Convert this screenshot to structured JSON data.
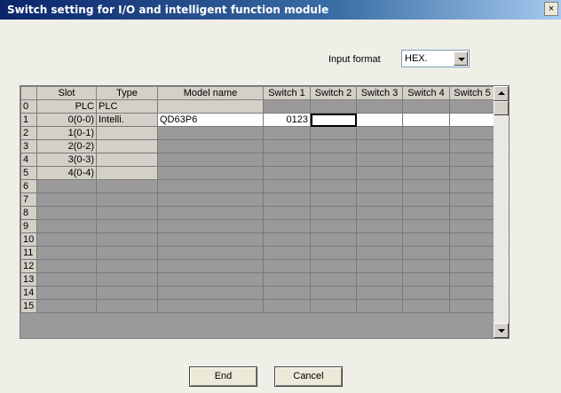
{
  "window": {
    "title": "Switch setting for I/O and intelligent function module",
    "close_label": "×"
  },
  "input_format": {
    "label": "Input format",
    "selected": "HEX."
  },
  "grid": {
    "columns": [
      "",
      "Slot",
      "Type",
      "Model name",
      "Switch 1",
      "Switch 2",
      "Switch 3",
      "Switch 4",
      "Switch 5"
    ],
    "rows": [
      {
        "index": "0",
        "slot": "PLC",
        "type": "PLC",
        "model": "",
        "s1": "",
        "s2": "",
        "s3": "",
        "s4": "",
        "s5": ""
      },
      {
        "index": "1",
        "slot": "0(0-0)",
        "type": "Intelli.",
        "model": "QD63P6",
        "s1": "0123",
        "s2": "",
        "s3": "",
        "s4": "",
        "s5": ""
      },
      {
        "index": "2",
        "slot": "1(0-1)",
        "type": "",
        "model": "",
        "s1": "",
        "s2": "",
        "s3": "",
        "s4": "",
        "s5": ""
      },
      {
        "index": "3",
        "slot": "2(0-2)",
        "type": "",
        "model": "",
        "s1": "",
        "s2": "",
        "s3": "",
        "s4": "",
        "s5": ""
      },
      {
        "index": "4",
        "slot": "3(0-3)",
        "type": "",
        "model": "",
        "s1": "",
        "s2": "",
        "s3": "",
        "s4": "",
        "s5": ""
      },
      {
        "index": "5",
        "slot": "4(0-4)",
        "type": "",
        "model": "",
        "s1": "",
        "s2": "",
        "s3": "",
        "s4": "",
        "s5": ""
      },
      {
        "index": "6",
        "slot": "",
        "type": "",
        "model": "",
        "s1": "",
        "s2": "",
        "s3": "",
        "s4": "",
        "s5": ""
      },
      {
        "index": "7",
        "slot": "",
        "type": "",
        "model": "",
        "s1": "",
        "s2": "",
        "s3": "",
        "s4": "",
        "s5": ""
      },
      {
        "index": "8",
        "slot": "",
        "type": "",
        "model": "",
        "s1": "",
        "s2": "",
        "s3": "",
        "s4": "",
        "s5": ""
      },
      {
        "index": "9",
        "slot": "",
        "type": "",
        "model": "",
        "s1": "",
        "s2": "",
        "s3": "",
        "s4": "",
        "s5": ""
      },
      {
        "index": "10",
        "slot": "",
        "type": "",
        "model": "",
        "s1": "",
        "s2": "",
        "s3": "",
        "s4": "",
        "s5": ""
      },
      {
        "index": "11",
        "slot": "",
        "type": "",
        "model": "",
        "s1": "",
        "s2": "",
        "s3": "",
        "s4": "",
        "s5": ""
      },
      {
        "index": "12",
        "slot": "",
        "type": "",
        "model": "",
        "s1": "",
        "s2": "",
        "s3": "",
        "s4": "",
        "s5": ""
      },
      {
        "index": "13",
        "slot": "",
        "type": "",
        "model": "",
        "s1": "",
        "s2": "",
        "s3": "",
        "s4": "",
        "s5": ""
      },
      {
        "index": "14",
        "slot": "",
        "type": "",
        "model": "",
        "s1": "",
        "s2": "",
        "s3": "",
        "s4": "",
        "s5": ""
      },
      {
        "index": "15",
        "slot": "",
        "type": "",
        "model": "",
        "s1": "",
        "s2": "",
        "s3": "",
        "s4": "",
        "s5": ""
      }
    ]
  },
  "buttons": {
    "end_label": "End",
    "cancel_label": "Cancel"
  }
}
